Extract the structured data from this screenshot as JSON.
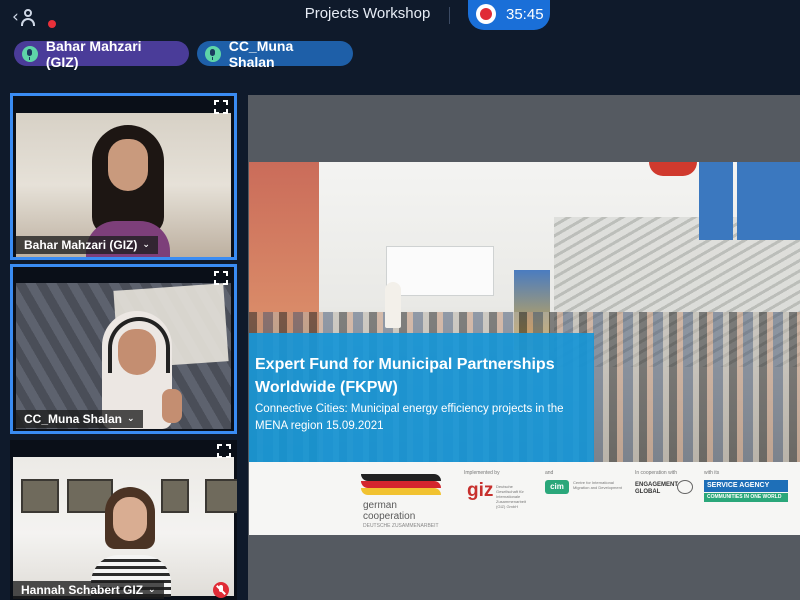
{
  "header": {
    "meeting_title": "Projects Workshop",
    "recording_timer": "35:45",
    "icons": {
      "back": "chevron-left-icon",
      "participants": "person-icon",
      "record": "record-icon"
    }
  },
  "speakers": [
    {
      "name": "Bahar Mahzari (GIZ)"
    },
    {
      "name": "CC_Muna Shalan"
    }
  ],
  "participants": [
    {
      "name": "Bahar Mahzari (GIZ)",
      "active": true,
      "muted": false
    },
    {
      "name": "CC_Muna Shalan",
      "active": true,
      "muted": false
    },
    {
      "name": "Hannah Schabert GIZ",
      "active": false,
      "muted": true
    }
  ],
  "slide": {
    "title": "Expert Fund for Municipal Partnerships Worldwide (FKPW)",
    "subtitle": "Connective Cities: Municipal energy efficiency projects in the MENA region 15.09.2021",
    "logos": {
      "german_line1": "german",
      "german_line2": "cooperation",
      "german_line3": "DEUTSCHE ZUSAMMENARBEIT",
      "giz_kicker": "Implemented by",
      "giz_text": "giz",
      "giz_small": "Deutsche Gesellschaft für Internationale Zusammenarbeit (GIZ) GmbH",
      "and_kicker": "and",
      "cim_text": "cim",
      "cim_small": "Centre for International Migration and Development",
      "eg_kicker": "In cooperation with",
      "eg_text": "ENGAGEMENT GLOBAL",
      "sa_kicker": "with its",
      "sa_line1": "SERVICE AGENCY",
      "sa_line2": "COMMUNITIES IN ONE WORLD"
    }
  },
  "colors": {
    "background": "#0f1a2b",
    "accent_blue": "#1a6fd8",
    "record_red": "#e02b36",
    "speaker_chip_1": "#4a3c99",
    "speaker_chip_2": "#1e5fa8",
    "slide_title_bg": "#1896d6"
  }
}
